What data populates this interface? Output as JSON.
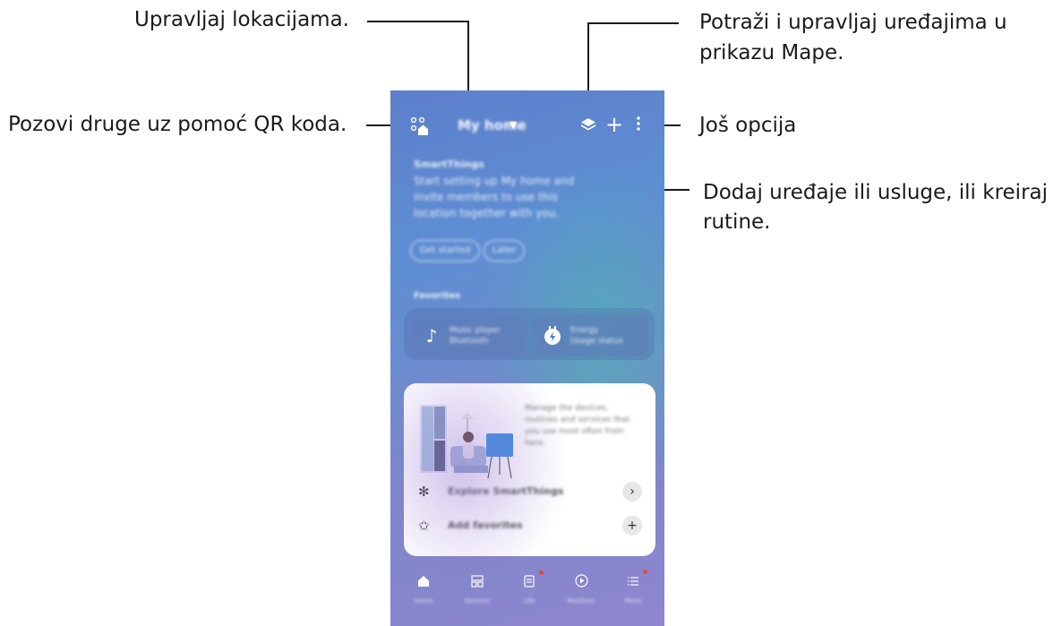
{
  "callouts": {
    "manage_locations": "Upravljaj lokacijama.",
    "invite_qr": "Pozovi druge uz pomoć QR koda.",
    "map_view_line1": "Potraži i upravljaj uređajima u",
    "map_view_line2": "prikazu Mape.",
    "more_options": "Još opcija",
    "add_devices_line1": "Dodaj uređaje ili usluge, ili kreiraj",
    "add_devices_line2": "rutine."
  },
  "phone": {
    "home_name": "My home",
    "welcome": {
      "title": "SmartThings",
      "line1": "Start setting up My home and",
      "line2": "invite members to use this",
      "line3": "location together with you."
    },
    "pills": [
      "Get started",
      "Later"
    ],
    "favorites_label": "Favorites",
    "favorites": [
      {
        "icon": "music-note-icon",
        "line1": "Music player",
        "line2": "Bluetooth"
      },
      {
        "icon": "plug-icon",
        "line1": "Energy",
        "line2": "Usage status"
      }
    ],
    "card": {
      "description": "Manage the devices, routines and services that you use most often from here.",
      "rows": [
        {
          "label": "Explore SmartThings",
          "action": "›"
        },
        {
          "label": "Add favorites",
          "action": "+"
        }
      ]
    },
    "nav": [
      {
        "label": "Home",
        "icon": "home-icon"
      },
      {
        "label": "Devices",
        "icon": "devices-icon"
      },
      {
        "label": "Life",
        "icon": "life-icon"
      },
      {
        "label": "Routines",
        "icon": "routines-icon"
      },
      {
        "label": "Menu",
        "icon": "menu-icon"
      }
    ]
  },
  "colors": {
    "background_top": "#5d7fcb",
    "background_bottom": "#8f86cf",
    "notification_dot": "#e8463a",
    "line": "#1a1a1a"
  }
}
